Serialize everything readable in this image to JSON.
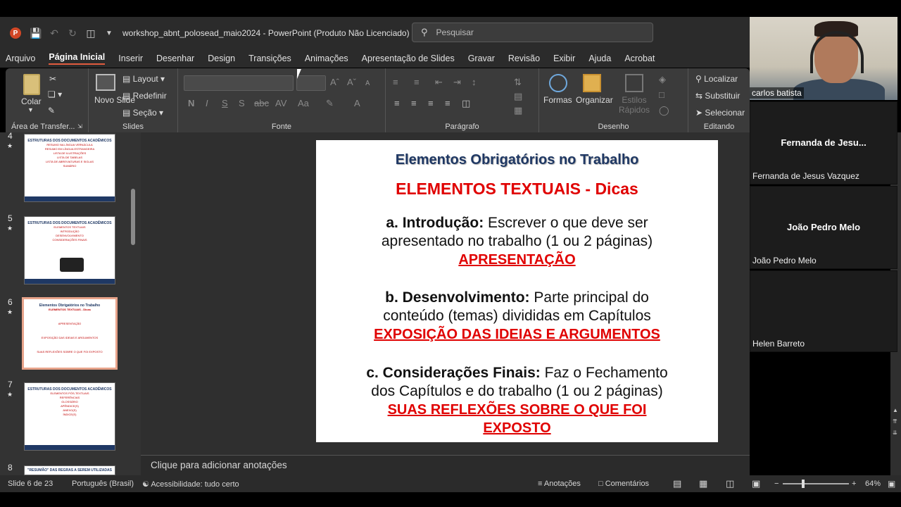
{
  "window": {
    "title": "workshop_abnt_polosead_maio2024  -  PowerPoint (Produto Não Licenciado)",
    "search_placeholder": "Pesquisar"
  },
  "menu": {
    "items": [
      "Arquivo",
      "Página Inicial",
      "Inserir",
      "Desenhar",
      "Design",
      "Transições",
      "Animações",
      "Apresentação de Slides",
      "Gravar",
      "Revisão",
      "Exibir",
      "Ajuda",
      "Acrobat"
    ],
    "active_index": 1
  },
  "ribbon": {
    "clipboard": {
      "paste": "Colar",
      "label": "Área de Transfer..."
    },
    "slides": {
      "new_slide": "Novo Slide",
      "layout": "Layout",
      "reset": "Redefinir",
      "section": "Seção",
      "label": "Slides"
    },
    "font": {
      "label": "Fonte"
    },
    "paragraph": {
      "label": "Parágrafo"
    },
    "drawing": {
      "shapes": "Formas",
      "arrange": "Organizar",
      "styles": "Estilos Rápidos",
      "label": "Desenho"
    },
    "editing": {
      "find": "Localizar",
      "replace": "Substituir",
      "select": "Selecionar",
      "label": "Editando"
    }
  },
  "thumbnails": [
    {
      "num": "4",
      "title": "ESTRUTURAS DOS DOCUMENTOS ACADÊMICOS",
      "lines": [
        "RESUMO NA LÍNGUA VERNÁCULA",
        "RESUMO EM LÍNGUA ESTRANGEIRA",
        "LISTA DE ILUSTRAÇÕES",
        "LISTA DE TABELAS",
        "LISTA DE ABREVIATURAS E SIGLAS",
        "SUMÁRIO"
      ]
    },
    {
      "num": "5",
      "title": "ESTRUTURAS DOS DOCUMENTOS ACADÊMICOS",
      "lines": [
        "ELEMENTOS TEXTUAIS",
        "INTRODUÇÃO",
        "DESENVOLVIMENTO",
        "CONSIDERAÇÕES FINAIS"
      ]
    },
    {
      "num": "6",
      "title": "Elementos Obrigatórios no Trabalho",
      "lines": [
        "ELEMENTOS TEXTUAIS - Dicas",
        "APRESENTAÇÃO",
        "EXPOSIÇÃO DAS IDEIAS E ARGUMENTOS",
        "SUAS REFLEXÕES SOBRE O QUE FOI EXPOSTO"
      ]
    },
    {
      "num": "7",
      "title": "ESTRUTURAS DOS DOCUMENTOS ACADÊMICOS",
      "lines": [
        "ELEMENTOS PÓS-TEXTUAIS",
        "REFERÊNCIAS",
        "GLOSSÁRIO",
        "APÊNDICE(S)",
        "ANEXO(S)",
        "ÍNDICE(S)"
      ]
    },
    {
      "num": "8",
      "title": "\"RESUMÃO\" DAS REGRAS A SEREM UTILIZADAS",
      "lines": []
    }
  ],
  "slide": {
    "title": "Elementos Obrigatórios no Trabalho",
    "subtitle": "ELEMENTOS TEXTUAIS - Dicas",
    "items": [
      {
        "head": "a.  Introdução:",
        "text1": " Escrever o que deve ser",
        "text2": "apresentado no trabalho (1 ou 2 páginas)",
        "red": "APRESENTAÇÃO"
      },
      {
        "head": "b. Desenvolvimento:",
        "text1": " Parte principal do",
        "text2": "conteúdo (temas) divididas em Capítulos",
        "red": "EXPOSIÇÃO DAS IDEIAS E ARGUMENTOS"
      },
      {
        "head": "c. Considerações Finais:",
        "text1": " Faz o Fechamento",
        "text2": "dos Capítulos e do trabalho (1 ou 2 páginas)",
        "red": "SUAS REFLEXÕES SOBRE O QUE FOI",
        "red2": "EXPOSTO"
      }
    ]
  },
  "notes_placeholder": "Clique para adicionar anotações",
  "status": {
    "slide_count": "Slide 6 de 23",
    "language": "Português (Brasil)",
    "accessibility": "Acessibilidade: tudo certo",
    "notes": "Anotações",
    "comments": "Comentários",
    "zoom": "64%"
  },
  "participants": [
    {
      "name": "carlos batista",
      "video": true
    },
    {
      "name": "Fernanda de Jesus Vazquez",
      "short": "Fernanda de Jesu..."
    },
    {
      "name": "João Pedro Melo",
      "short": "João Pedro Melo"
    },
    {
      "name": "Helen Barreto",
      "short": ""
    }
  ]
}
